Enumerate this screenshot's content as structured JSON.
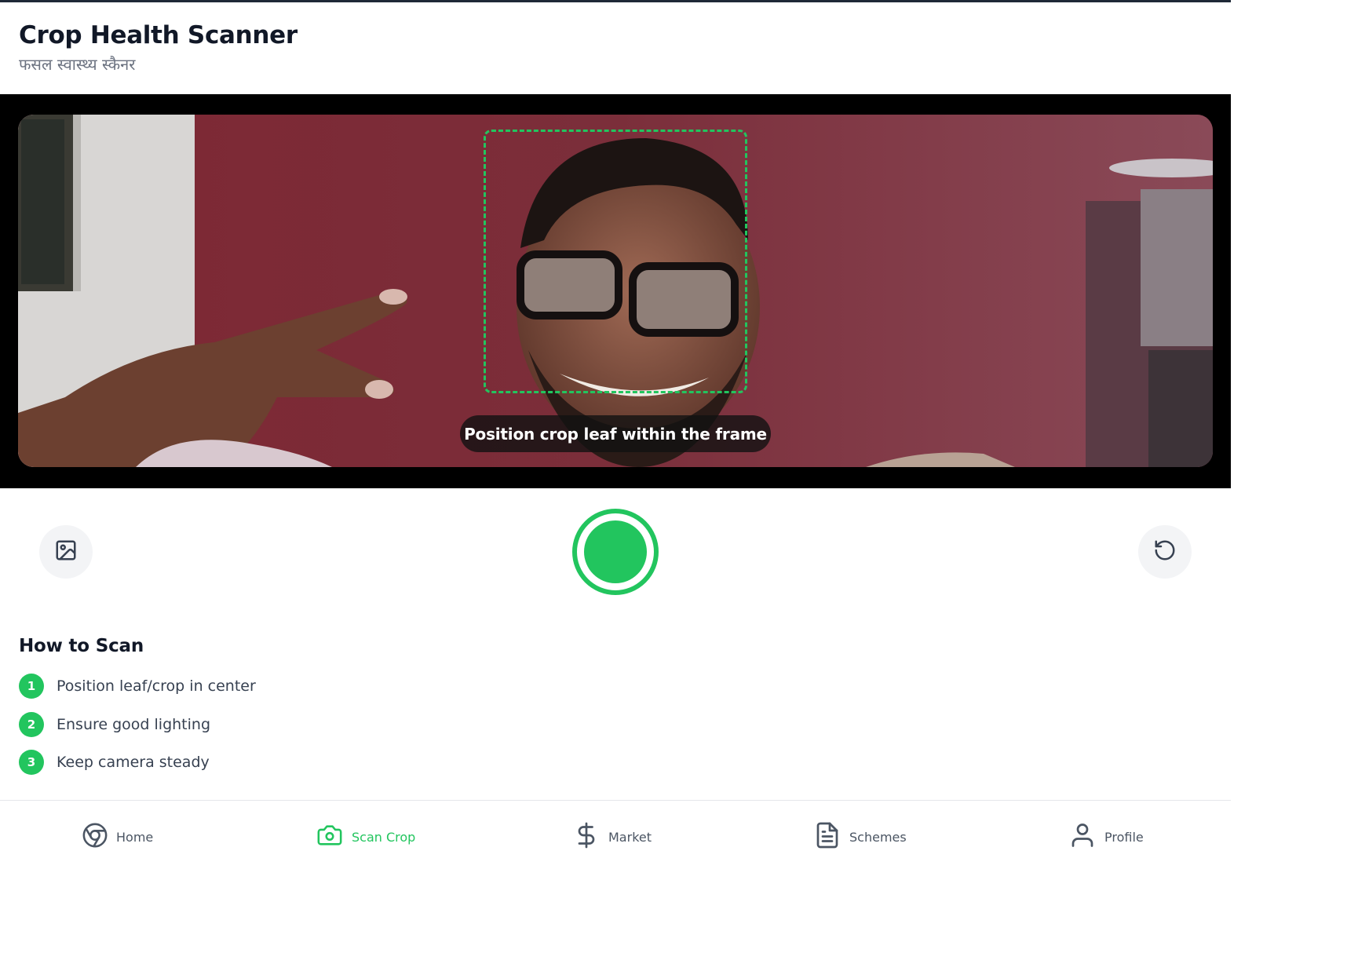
{
  "header": {
    "title": "Crop Health Scanner",
    "subtitle": "फसल स्वास्थ्य स्कैनर"
  },
  "camera": {
    "hint": "Position crop leaf within the frame"
  },
  "controls": {
    "gallery_icon": "image-icon",
    "reset_icon": "rotate-ccw-icon",
    "capture_icon": "shutter-button"
  },
  "how_to": {
    "title": "How to Scan",
    "steps": [
      {
        "num": "1",
        "text": "Position leaf/crop in center"
      },
      {
        "num": "2",
        "text": "Ensure good lighting"
      },
      {
        "num": "3",
        "text": "Keep camera steady"
      }
    ]
  },
  "nav": {
    "items": [
      {
        "label": "Home",
        "icon": "chrome-icon"
      },
      {
        "label": "Scan Crop",
        "icon": "camera-icon",
        "active": true
      },
      {
        "label": "Market",
        "icon": "dollar-icon"
      },
      {
        "label": "Schemes",
        "icon": "file-text-icon"
      },
      {
        "label": "Profile",
        "icon": "user-icon"
      }
    ]
  },
  "colors": {
    "accent": "#22c55e",
    "text_dark": "#111827",
    "text_muted": "#6b7280"
  }
}
